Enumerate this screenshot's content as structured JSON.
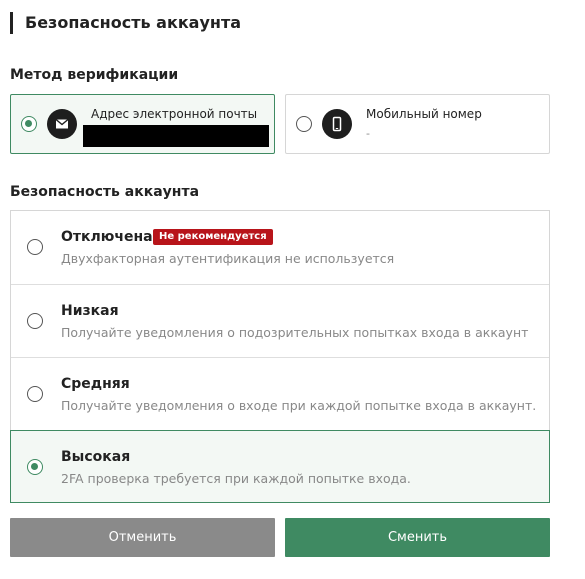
{
  "page": {
    "title": "Безопасность аккаунта"
  },
  "verification": {
    "label": "Метод верификации",
    "methods": [
      {
        "title": "Адрес электронной почты",
        "icon": "mail-icon",
        "selected": true
      },
      {
        "title": "Мобильный номер",
        "value": "-",
        "icon": "mobile-phone-icon",
        "selected": false
      }
    ]
  },
  "security": {
    "label": "Безопасность аккаунта",
    "options": [
      {
        "title": "Отключена",
        "badge": "Не рекомендуется",
        "description": "Двухфакторная аутентификация не используется",
        "selected": false
      },
      {
        "title": "Низкая",
        "description": "Получайте уведомления о подозрительных попытках входа в аккаунт",
        "selected": false
      },
      {
        "title": "Средняя",
        "description": "Получайте уведомления о входе при каждой попытке входа в аккаунт.",
        "selected": false
      },
      {
        "title": "Высокая",
        "description": "2FA проверка требуется при каждой попытке входа.",
        "selected": true
      }
    ]
  },
  "actions": {
    "cancel_label": "Отменить",
    "submit_label": "Сменить"
  },
  "colors": {
    "accent": "#3f8a62",
    "badge": "#b8141a",
    "cancel": "#8a8a8a"
  }
}
